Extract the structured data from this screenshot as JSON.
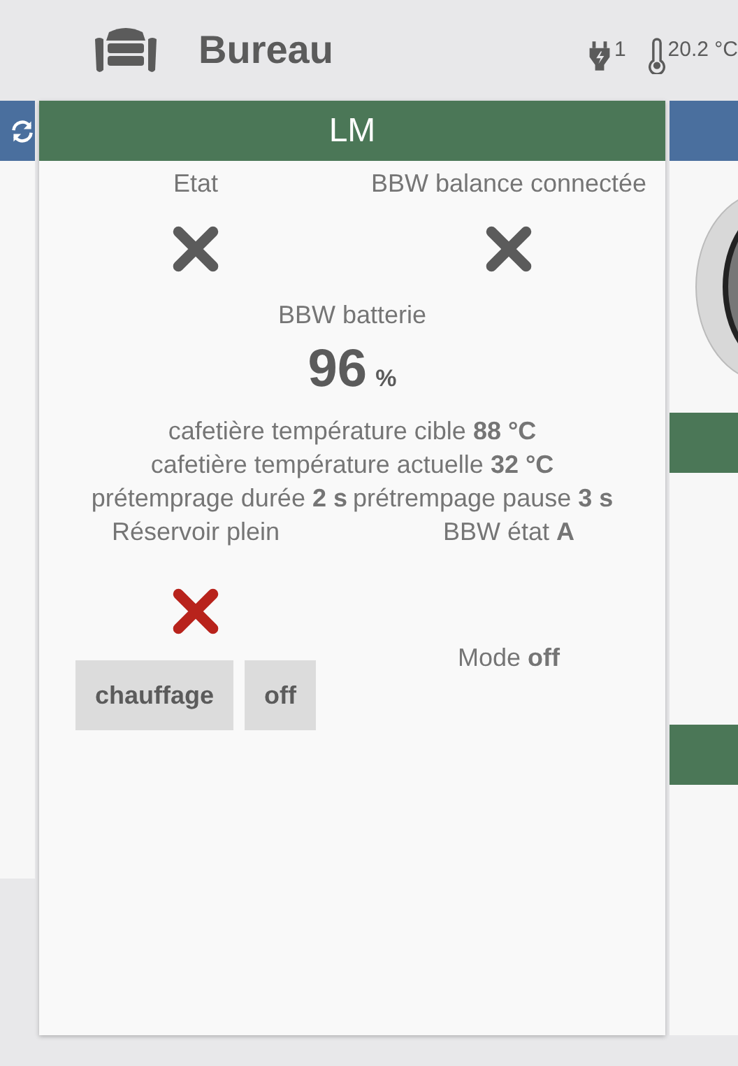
{
  "header": {
    "title": "Bureau",
    "power_count": "1",
    "temperature": "20.2 °C"
  },
  "card": {
    "title": "LM",
    "top_indicators": [
      {
        "label": "Etat",
        "on": false,
        "alarm": false
      },
      {
        "label": "BBW balance connectée",
        "on": false,
        "alarm": false
      }
    ],
    "battery": {
      "label": "BBW batterie",
      "value": "96",
      "unit": "%"
    },
    "readings": [
      {
        "label": "cafetière température cible",
        "value": "88 °C"
      },
      {
        "label": "cafetière température actuelle",
        "value": "32 °C"
      }
    ],
    "pair_readings": [
      {
        "label": "prétemprage durée",
        "value": "2 s"
      },
      {
        "label": "prétrempage pause",
        "value": "3 s"
      }
    ],
    "tank": {
      "label": "Réservoir plein",
      "on": false,
      "alarm": true
    },
    "buttons": [
      {
        "label": "chauffage"
      },
      {
        "label": "off"
      }
    ],
    "state_reading": {
      "label": "BBW état",
      "value": "A"
    },
    "mode": {
      "label": "Mode",
      "value": "off"
    }
  }
}
